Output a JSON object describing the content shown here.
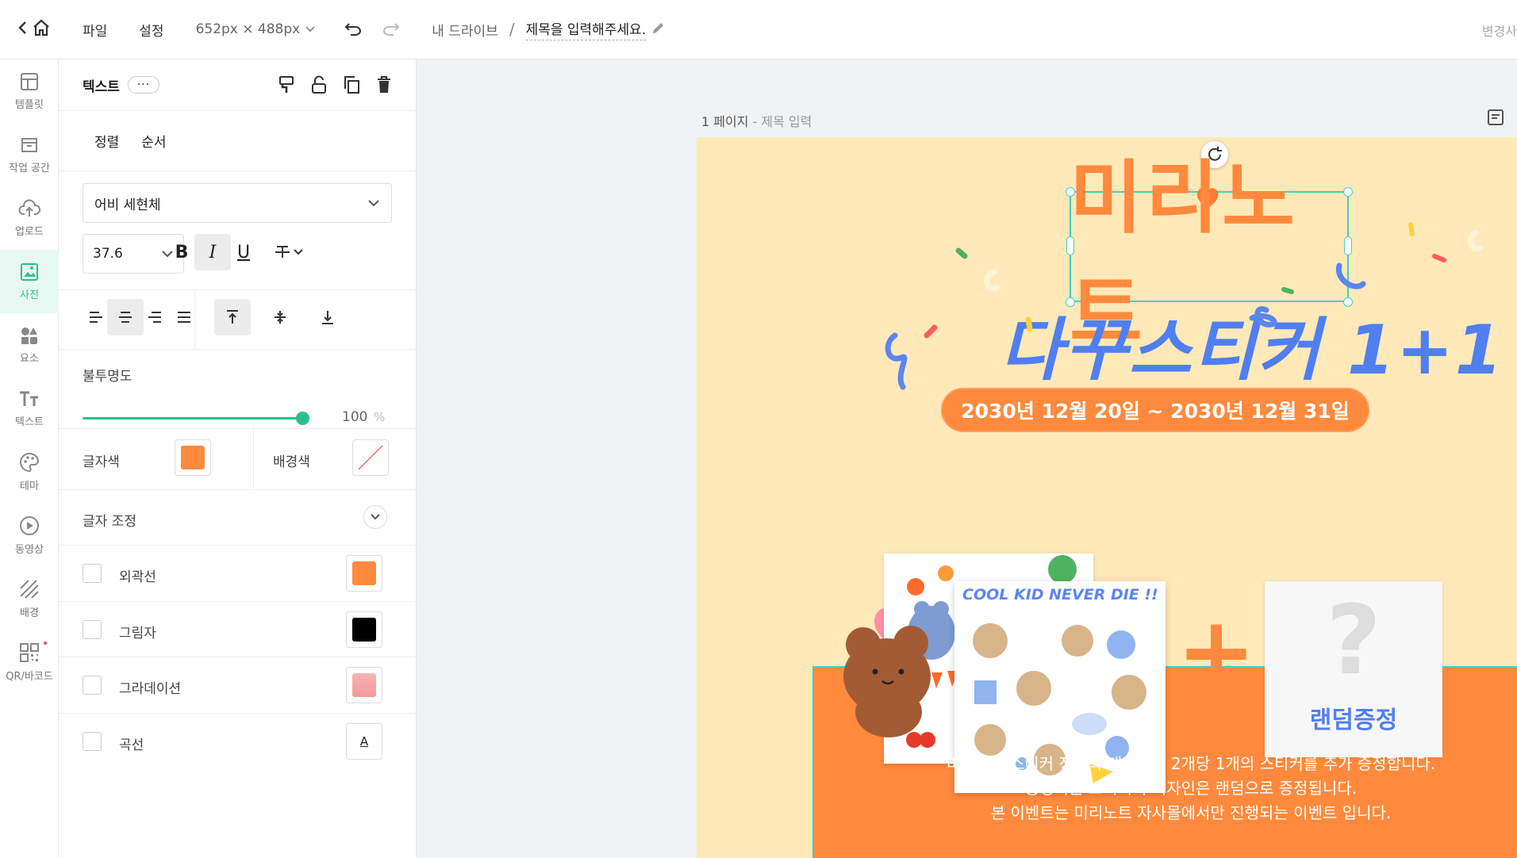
{
  "topbar": {
    "menu_file": "파일",
    "menu_settings": "설정",
    "dimensions": "652px × 488px",
    "breadcrumb_drive": "내 드라이브",
    "breadcrumb_sep": "/",
    "doc_title": "제목을 입력해주세요.",
    "right_text": "변경사"
  },
  "sidebar": {
    "items": [
      {
        "label": "템플릿",
        "icon": "template-icon"
      },
      {
        "label": "작업 공간",
        "icon": "workspace-icon"
      },
      {
        "label": "업로드",
        "icon": "upload-icon"
      },
      {
        "label": "사진",
        "icon": "photo-icon"
      },
      {
        "label": "요소",
        "icon": "elements-icon"
      },
      {
        "label": "텍스트",
        "icon": "text-icon"
      },
      {
        "label": "테마",
        "icon": "palette-icon"
      },
      {
        "label": "동영상",
        "icon": "video-icon"
      },
      {
        "label": "배경",
        "icon": "background-icon"
      },
      {
        "label": "QR/바코드",
        "icon": "qr-icon"
      }
    ]
  },
  "panel": {
    "header_label": "텍스트",
    "more": "···",
    "tab_align": "정렬",
    "tab_order": "순서",
    "font_family": "어비 세현체",
    "font_size": "37.6",
    "bold": "B",
    "italic": "I",
    "underline": "U",
    "opacity_label": "불투명도",
    "opacity_value": "100",
    "opacity_unit": "%",
    "opacity_level": 1.0,
    "text_color_label": "글자색",
    "bg_color_label": "배경색",
    "text_adjust_label": "글자 조정",
    "options": [
      {
        "label": "외곽선",
        "color": "#ff8a3d"
      },
      {
        "label": "그림자",
        "color": "#000000"
      },
      {
        "label": "그라데이션",
        "color": "#f7a8a8"
      },
      {
        "label": "곡선",
        "color": ""
      }
    ],
    "text_color": "#ff8a3d",
    "curve_icon_glyph": "A"
  },
  "canvas": {
    "page_label_num": "1 페이지",
    "page_label_sep": " - ",
    "page_label_title": "제목 입력",
    "headline": "미리노트",
    "subheadline": "다꾸스티커 1+1",
    "date_range": "2030년 12월 20일 ~ 2030년 12월 31일",
    "sticker_heading": "COOL KID NEVER DIE !!",
    "plus": "+",
    "question": "?",
    "random_label": "랜덤증정",
    "desc_line1": "미리노트 스티커 전품목 대상으로 2개당 1개의 스티커를 추가 증정합니다.",
    "desc_line2": "증정되는 스티커의 디자인은 랜덤으로 증정됩니다.",
    "desc_line3": "본 이벤트는 미리노트 자사몰에서만 진행되는 이벤트 입니다.",
    "colors": {
      "page_bg": "#ffe9b8",
      "orange": "#ff8a3d",
      "blue": "#4f7ff0",
      "selection": "#3ed0c4"
    }
  }
}
